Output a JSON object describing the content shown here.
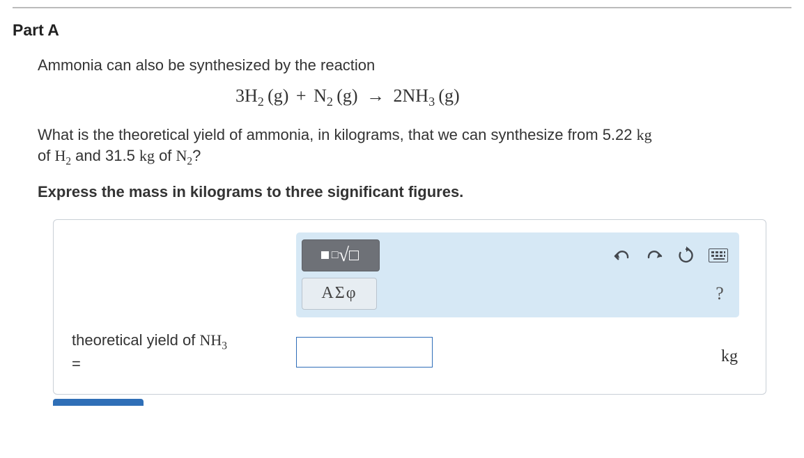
{
  "part_label": "Part A",
  "intro_text": "Ammonia can also be synthesized by the reaction",
  "equation": {
    "coef1": "3",
    "species1_base": "H",
    "species1_sub": "2",
    "state1": "(g)",
    "plus": "+",
    "coef2": "",
    "species2_base": "N",
    "species2_sub": "2",
    "state2": "(g)",
    "arrow": "→",
    "coef3": "2",
    "species3_base": "NH",
    "species3_sub": "3",
    "state3": "(g)"
  },
  "question": {
    "lead": "What is the theoretical yield of ammonia, in kilograms, that we can synthesize from ",
    "mass1": "5.22",
    "unit1": "kg",
    "of1": " of ",
    "sp1_base": "H",
    "sp1_sub": "2",
    "and_text": " and ",
    "mass2": "31.5",
    "unit2": "kg",
    "of2": " of ",
    "sp2_base": "N",
    "sp2_sub": "2",
    "qmark": "?"
  },
  "instruction": "Express the mass in kilograms to three significant figures.",
  "toolbar": {
    "templates_label": "templates",
    "symbols_label": "ΑΣφ",
    "undo": "undo",
    "redo": "redo",
    "reset": "reset",
    "keyboard": "keyboard",
    "help": "?"
  },
  "answer": {
    "label_prefix": "theoretical yield of ",
    "species_base": "NH",
    "species_sub": "3",
    "equals": " =",
    "value": "",
    "unit": "kg"
  }
}
